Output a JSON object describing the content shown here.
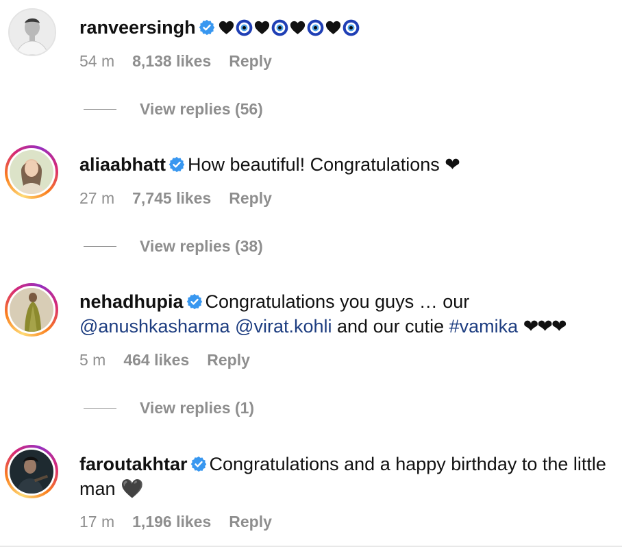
{
  "comments": [
    {
      "username": "ranveersingh",
      "verified": true,
      "avatar": "ranveersingh-avatar",
      "has_story_ring": false,
      "text_emoji": "🖤🧿🖤🧿🖤🧿🖤🧿",
      "time": "54 m",
      "likes": "8,138 likes",
      "reply": "Reply",
      "view_replies": "View replies (56)"
    },
    {
      "username": "aliaabhatt",
      "verified": true,
      "avatar": "aliaabhatt-avatar",
      "has_story_ring": true,
      "text": "How beautiful! Congratulations ❤",
      "time": "27 m",
      "likes": "7,745 likes",
      "reply": "Reply",
      "view_replies": "View replies (38)"
    },
    {
      "username": "nehadhupia",
      "verified": true,
      "avatar": "nehadhupia-avatar",
      "has_story_ring": true,
      "text_part1": "Congratulations you guys … our",
      "mention1": "@anushkasharma",
      "mention2": "@virat.kohli",
      "text_part2": "and our cutie",
      "hashtag": "#vamika",
      "text_part3": "❤❤❤",
      "time": "5 m",
      "likes": "464 likes",
      "reply": "Reply",
      "view_replies": "View replies (1)"
    },
    {
      "username": "faroutakhtar",
      "verified": true,
      "avatar": "faroutakhtar-avatar",
      "has_story_ring": true,
      "text": "Congratulations and a happy birthday to the little man 🖤",
      "time": "17 m",
      "likes": "1,196 likes",
      "reply": "Reply"
    }
  ],
  "colors": {
    "verified_badge": "#3897f0",
    "link": "#1d3d80",
    "meta": "#8e8e8e"
  }
}
